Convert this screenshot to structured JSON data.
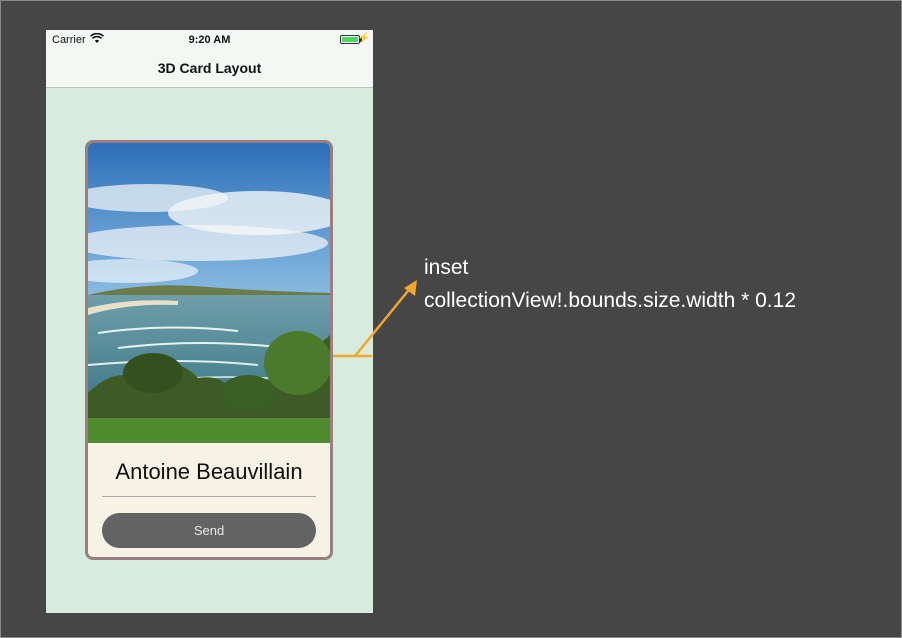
{
  "status_bar": {
    "carrier": "Carrier",
    "time": "9:20 AM"
  },
  "nav": {
    "title": "3D Card Layout"
  },
  "card": {
    "name": "Antoine Beauvillain",
    "button_label": "Send"
  },
  "annotation": {
    "label": "inset",
    "formula": "collectionView!.bounds.size.width * 0.12",
    "color": "#f2a62a"
  },
  "colors": {
    "background": "#464646",
    "phone_background": "#d7ebde",
    "card_border": "#9a7e80",
    "card_background": "#f6f2e6",
    "button": "#636363"
  },
  "icons": [
    "wifi-icon",
    "battery-icon",
    "charging-icon"
  ]
}
